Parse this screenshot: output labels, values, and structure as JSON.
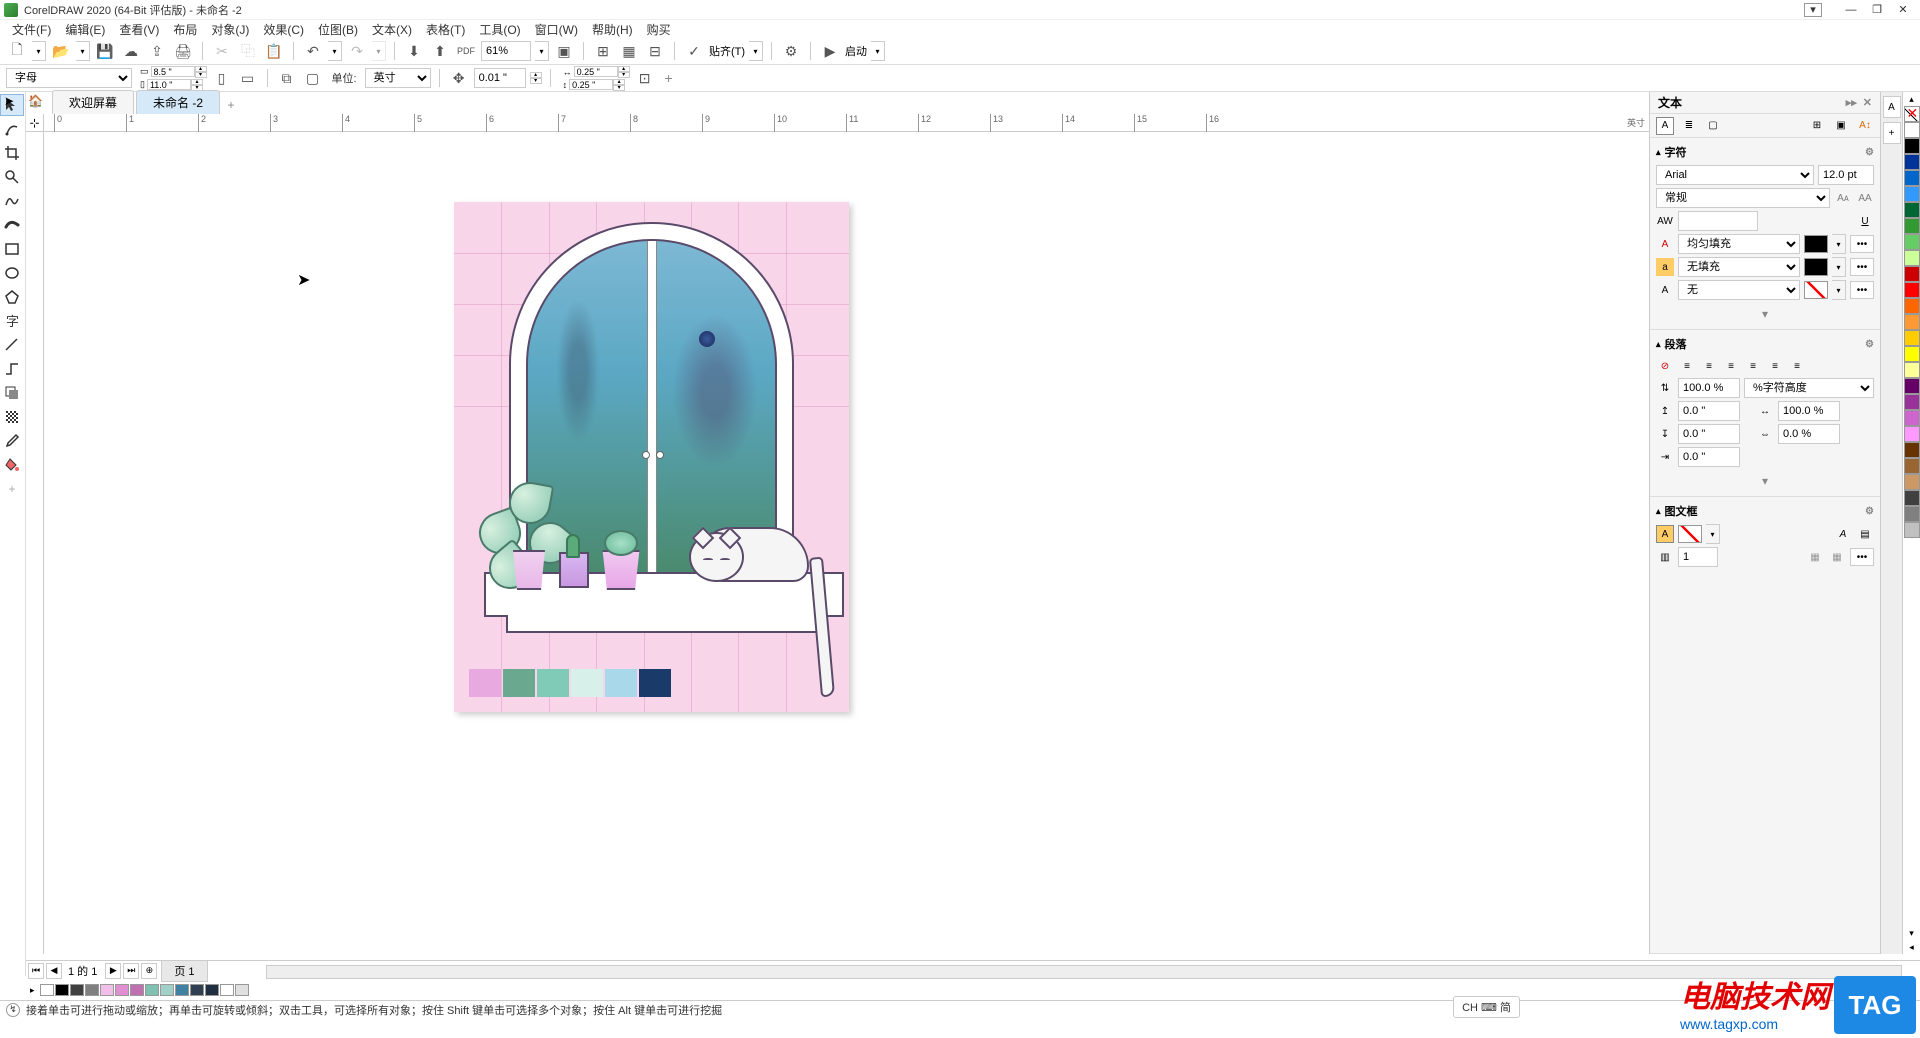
{
  "app": {
    "title": "CorelDRAW 2020 (64-Bit 评估版) - 未命名 -2"
  },
  "menu": [
    "文件(F)",
    "编辑(E)",
    "查看(V)",
    "布局",
    "对象(J)",
    "效果(C)",
    "位图(B)",
    "文本(X)",
    "表格(T)",
    "工具(O)",
    "窗口(W)",
    "帮助(H)",
    "购买"
  ],
  "toolbar1": {
    "zoom": "61%",
    "snap_label": "贴齐(T)",
    "launch_label": "启动"
  },
  "propertybar": {
    "preset": "字母",
    "page_w": "8.5 \"",
    "page_h": "11.0 \"",
    "unit_label": "单位:",
    "unit_value": "英寸",
    "nudge": "0.01 \"",
    "dup_x": "0.25 \"",
    "dup_y": "0.25 \""
  },
  "tabs": {
    "welcome": "欢迎屏幕",
    "doc": "未命名 -2"
  },
  "ruler": {
    "unit": "英寸",
    "h_ticks": [
      "0",
      "1",
      "2",
      "3",
      "4",
      "5",
      "6",
      "7",
      "8",
      "9",
      "10",
      "11",
      "12",
      "13",
      "14",
      "15",
      "16"
    ]
  },
  "artwork_swatches": [
    "#e8a8e0",
    "#6aa890",
    "#80cab8",
    "#d8f0ea",
    "#a8d8ea",
    "#1a3a6a"
  ],
  "docker": {
    "title": "文本",
    "section_char": "字符",
    "font": "Arial",
    "font_size": "12.0 pt",
    "font_style": "常规",
    "fill_label": "均匀填充",
    "bgfill_label": "无填充",
    "outline_label": "无",
    "section_para": "段落",
    "line_spacing": "100.0 %",
    "spacing_mode": "%字符高度",
    "before_para": "0.0 \"",
    "char_spacing": "100.0 %",
    "after_para": "0.0 \"",
    "word_spacing": "0.0 %",
    "indent": "0.0 \"",
    "section_frame": "图文框",
    "columns": "1"
  },
  "palette_colors": [
    "#ffffff",
    "#000000",
    "#003399",
    "#0066cc",
    "#3399ff",
    "#006633",
    "#339933",
    "#66cc66",
    "#ccff99",
    "#cc0000",
    "#ff0000",
    "#ff6600",
    "#ff9933",
    "#ffcc00",
    "#ffff00",
    "#ffff99",
    "#660066",
    "#993399",
    "#cc66cc",
    "#ff99ff",
    "#663300",
    "#996633",
    "#cc9966",
    "#404040",
    "#808080",
    "#c0c0c0"
  ],
  "doc_palette": [
    "#ffffff",
    "#000000",
    "#404040",
    "#808080",
    "#f0c0e8",
    "#e090d0",
    "#c070b0",
    "#80c0b0",
    "#a0d0c8",
    "#4080a0",
    "#304050",
    "#203040",
    "#ffffff",
    "#e0e0e0"
  ],
  "page_nav": {
    "counter": "1 的 1",
    "page_label": "页 1"
  },
  "status": {
    "text": "接着单击可进行拖动或缩放；再单击可旋转或倾斜；双击工具，可选择所有对象；按住 Shift 键单击可选择多个对象；按住 Alt 键单击可进行挖掘",
    "ime": "CH ⌨ 简"
  },
  "watermark": {
    "red": "电脑技术网",
    "blue": "www.tagxp.com",
    "tag": "TAG"
  }
}
